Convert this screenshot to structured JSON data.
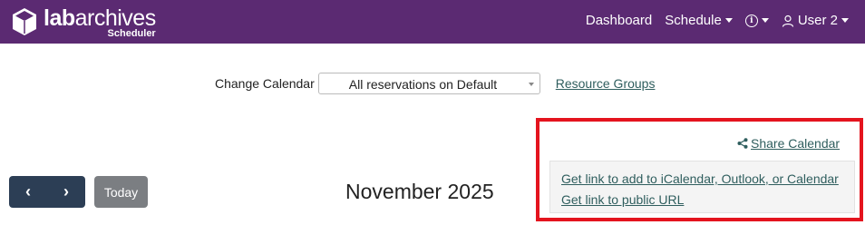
{
  "header": {
    "logo": {
      "main_bold": "lab",
      "main_rest": "archives",
      "sub": "Scheduler"
    },
    "nav": {
      "dashboard": "Dashboard",
      "schedule": "Schedule",
      "info_icon": "info-icon",
      "user": "User 2"
    },
    "color": "#5b2a72"
  },
  "calendar_selector": {
    "label": "Change Calendar",
    "selected": "All reservations on Default",
    "resource_groups_link": "Resource Groups"
  },
  "share": {
    "share_calendar": "Share Calendar",
    "icalendar_link": "Get link to add to iCalendar, Outlook, or Calendar",
    "public_url_link": "Get link to public URL",
    "highlight_color": "#e4141e"
  },
  "controls": {
    "prev_icon": "‹",
    "next_icon": "›",
    "today": "Today",
    "month": "November 2025"
  }
}
